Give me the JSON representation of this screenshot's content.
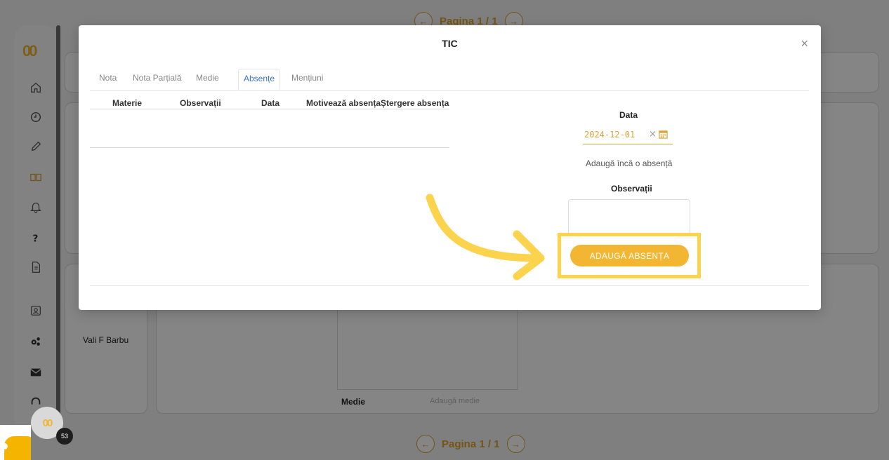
{
  "app": {
    "logo": "00",
    "sidebar_icons": [
      "home-icon",
      "clock-icon",
      "pencil-icon",
      "book-icon",
      "bell-icon",
      "question-icon",
      "document-icon",
      "contact-icon",
      "settings-icon",
      "mail-icon",
      "headset-icon"
    ],
    "pager_top": "Pagina 1 / 1",
    "pager_bottom": "Pagina 1 / 1",
    "student_name": "Vali F Barbu",
    "medie_label": "Medie",
    "medie_placeholder": "Adaugă medie"
  },
  "modal": {
    "title": "TIC",
    "close": "×",
    "tabs": [
      "Nota",
      "Nota Parțială",
      "Medie",
      "Absențe",
      "Mențiuni"
    ],
    "active_tab": "Absențe",
    "table_headers": [
      "Materie",
      "Observații",
      "Data",
      "Motivează absența",
      "Ștergere absența"
    ],
    "date_label": "Data",
    "date_value": "2024-12-01",
    "date_clear": "×",
    "add_more": "Adaugă încă o absență",
    "observations_label": "Observații",
    "add_button": "ADAUGĂ ABSENȚA"
  },
  "widget": {
    "chat_label": "00",
    "chat_count": "53"
  },
  "colors": {
    "accent": "#f2b632",
    "highlight": "#fcd34d",
    "tab_active": "#3a74c6"
  }
}
